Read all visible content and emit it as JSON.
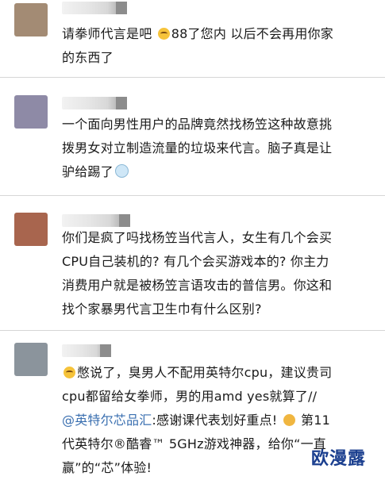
{
  "comments": [
    {
      "avatar_color": "#a38b74",
      "lines": [
        "请拳师代言是吧",
        "88了您内  以后不会再用你家",
        "的东西了"
      ]
    },
    {
      "avatar_color": "#8e8aa6",
      "lines": [
        "一个面向男性用户的品牌竟然找杨笠这种故意挑",
        "拨男女对立制造流量的垃圾来代言。脑子真是让",
        "驴给踢了"
      ]
    },
    {
      "avatar_color": "#a8654e",
      "lines": [
        "你们是疯了吗找杨笠当代言人，女生有几个会买",
        "CPU自己装机的? 有几个会买游戏本的? 你主力",
        "消费用户就是被杨笠言语攻击的普信男。你这和",
        "找个家暴男代言卫生巾有什么区别?"
      ]
    },
    {
      "avatar_color": "#8b949c",
      "lines": [
        "憋说了，臭男人不配用英特尔cpu，建议贵司",
        "cpu都留给女拳师，男的用amd yes就算了//"
      ],
      "mention": "@英特尔芯品汇",
      "mention_text": ":感谢课代表划好重点!",
      "line4_tail": "第11",
      "line5": "代英特尔®酷睿™ 5GHz游戏神器，给你“一直",
      "line6": "赢”的“芯”体验!"
    }
  ],
  "watermark": "欧漫露"
}
